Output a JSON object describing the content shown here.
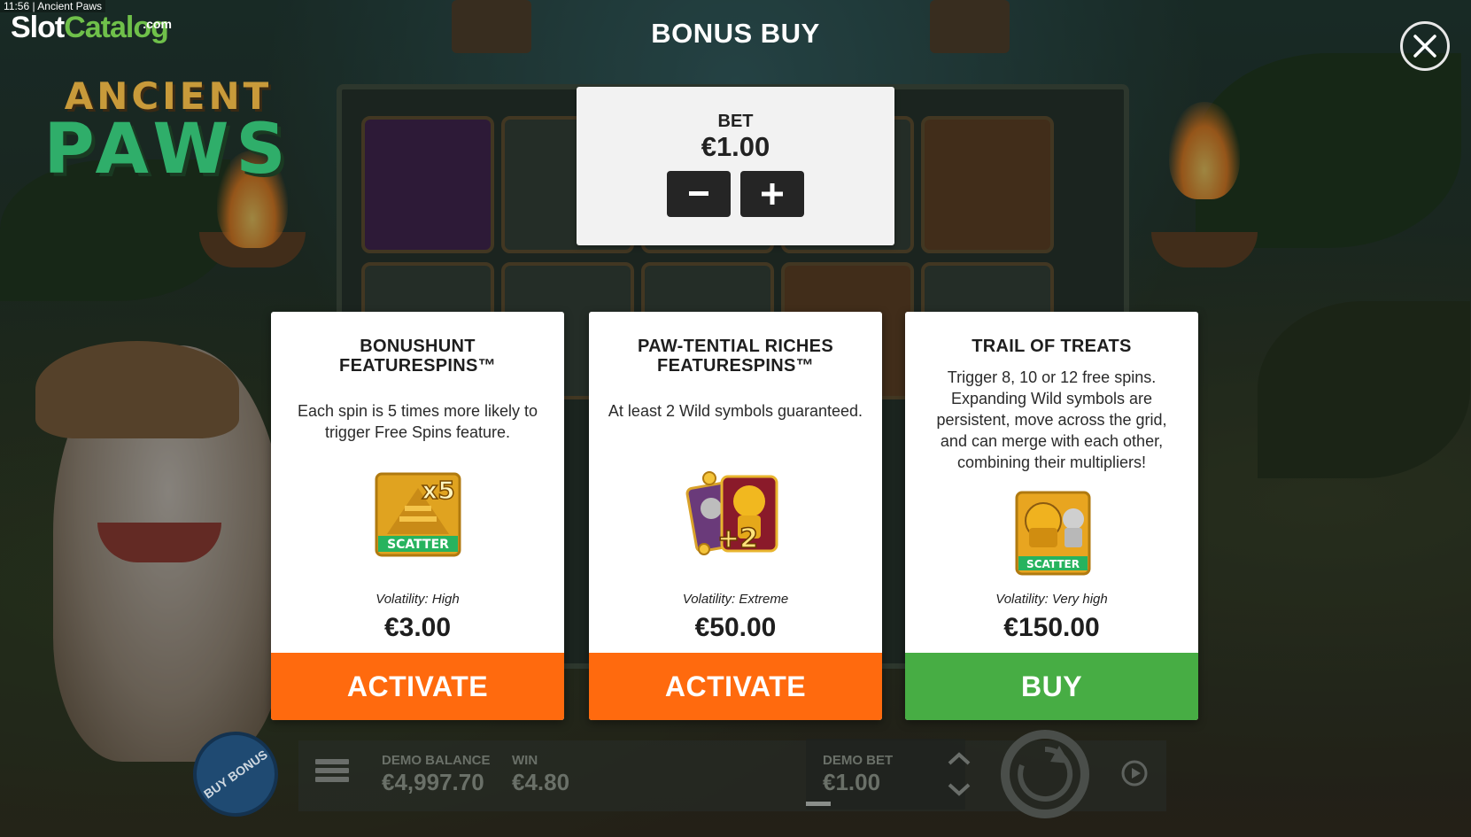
{
  "window": {
    "time": "11:56",
    "title": "Ancient Paws"
  },
  "logo": {
    "slot": "Slot",
    "catalog": "Catalog",
    "com": ".com"
  },
  "game_logo": {
    "line1": "ANCIENT",
    "line2": "PAWS"
  },
  "modal": {
    "title": "BONUS BUY",
    "close_icon": "close-icon",
    "bet": {
      "label": "BET",
      "value": "€1.00",
      "minus_icon": "minus-icon",
      "plus_icon": "plus-icon"
    }
  },
  "cards": [
    {
      "title_line1": "BONUSHUNT",
      "title_line2": "FEATURESPINS™",
      "description": "Each spin is 5 times more likely to trigger Free Spins feature.",
      "image_label": "x5",
      "image_caption": "SCATTER",
      "volatility": "Volatility: High",
      "price": "€3.00",
      "button": "ACTIVATE",
      "button_color": "#ff6a0e"
    },
    {
      "title_line1": "PAW-TENTIAL RICHES",
      "title_line2": "FEATURESPINS™",
      "description": "At least 2 Wild symbols guaranteed.",
      "image_label": "+2",
      "volatility": "Volatility: Extreme",
      "price": "€50.00",
      "button": "ACTIVATE",
      "button_color": "#ff6a0e"
    },
    {
      "title_line1": "TRAIL OF TREATS",
      "title_line2": "",
      "description": "Trigger 8, 10 or 12 free spins. Expanding Wild symbols are persistent, move across the grid, and can merge with each other, combining their multipliers!",
      "image_caption": "SCATTER",
      "volatility": "Volatility: Very high",
      "price": "€150.00",
      "button": "BUY",
      "button_color": "#47ad44"
    }
  ],
  "hud": {
    "buy_bonus": "BUY BONUS",
    "demo_balance_label": "DEMO BALANCE",
    "demo_balance_value": "€4,997.70",
    "win_label": "WIN",
    "win_value": "€4.80",
    "demo_bet_label": "DEMO BET",
    "demo_bet_value": "€1.00"
  }
}
